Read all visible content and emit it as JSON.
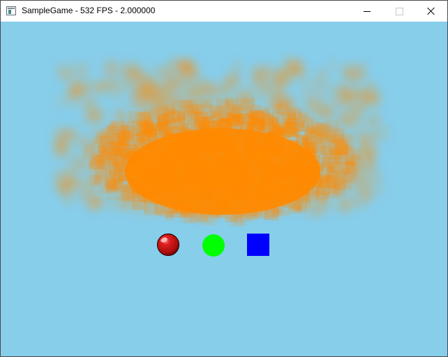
{
  "window": {
    "title": "SampleGame - 532 FPS - 2.000000",
    "icons": {
      "app": "app-window-icon",
      "minimize": "minimize-icon",
      "maximize": "maximize-icon",
      "close": "close-icon"
    }
  },
  "scene": {
    "background_color": "#87ceeb",
    "particles": {
      "color": "#ff8a00",
      "description_name": "orange-particle-cloud"
    },
    "objects": [
      {
        "name": "red-ball-sprite",
        "shape": "sphere",
        "color": "#cc1111"
      },
      {
        "name": "green-circle",
        "shape": "circle",
        "color": "#00ff00"
      },
      {
        "name": "blue-square",
        "shape": "square",
        "color": "#0000ff"
      }
    ]
  }
}
